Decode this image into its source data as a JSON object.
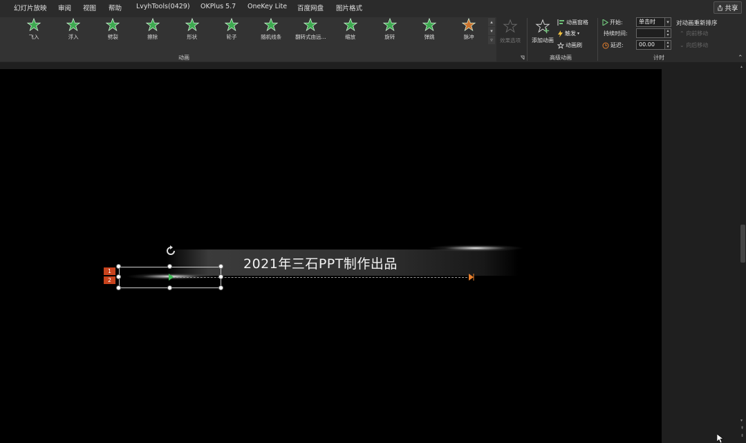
{
  "menubar": {
    "items": [
      "幻灯片放映",
      "审阅",
      "视图",
      "帮助",
      "LvyhTools(0429)",
      "OKPlus 5.7",
      "OneKey Lite",
      "百度网盘",
      "图片格式"
    ],
    "share": "共享"
  },
  "ribbon": {
    "animations": [
      {
        "label": "飞入",
        "icon": "fly-in-star-icon",
        "color": "#3fbf56"
      },
      {
        "label": "浮入",
        "icon": "float-in-star-icon",
        "color": "#3fbf56"
      },
      {
        "label": "劈裂",
        "icon": "split-star-icon",
        "color": "#3fbf56"
      },
      {
        "label": "擦除",
        "icon": "wipe-star-icon",
        "color": "#3fbf56"
      },
      {
        "label": "形状",
        "icon": "shape-star-icon",
        "color": "#3fbf56"
      },
      {
        "label": "轮子",
        "icon": "wheel-star-icon",
        "color": "#3fbf56"
      },
      {
        "label": "随机线条",
        "icon": "random-bars-star-icon",
        "color": "#3fbf56"
      },
      {
        "label": "翻转式由远...",
        "icon": "grow-turn-star-icon",
        "color": "#3fbf56"
      },
      {
        "label": "缩放",
        "icon": "zoom-star-icon",
        "color": "#3fbf56"
      },
      {
        "label": "旋转",
        "icon": "swivel-star-icon",
        "color": "#3fbf56"
      },
      {
        "label": "弹跳",
        "icon": "bounce-star-icon",
        "color": "#3fbf56"
      },
      {
        "label": "脉冲",
        "icon": "pulse-star-icon",
        "color": "#e8802e"
      }
    ],
    "effect_options": "效果选项",
    "group_animation": "动画",
    "add_animation": "添加动画",
    "animation_pane": "动画窗格",
    "trigger": "触发",
    "animation_painter": "动画刷",
    "group_advanced": "高级动画",
    "start_label": "开始:",
    "start_value": "单击时",
    "duration_label": "持续时间:",
    "duration_value": "",
    "delay_label": "延迟:",
    "delay_value": "00.00",
    "group_timing": "计时",
    "reorder_title": "对动画重新排序",
    "move_earlier": "向前移动",
    "move_later": "向后移动"
  },
  "slide": {
    "title": "2021年三石PPT制作出品",
    "tags": [
      "1",
      "2"
    ]
  },
  "colors": {
    "accent_green": "#3fbf56",
    "accent_orange": "#e8802e",
    "tag_red": "#c8431d"
  }
}
